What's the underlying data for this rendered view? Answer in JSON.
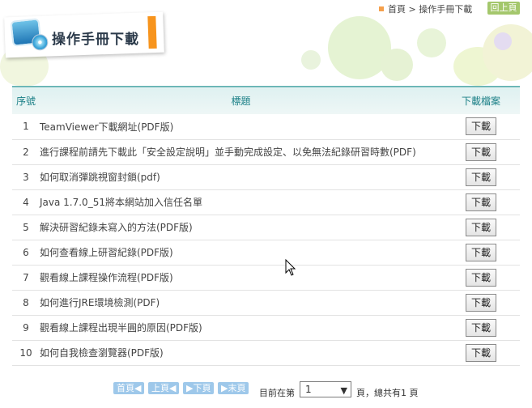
{
  "breadcrumb": {
    "home": "首頁",
    "separator": ">",
    "current": "操作手冊下載"
  },
  "back_button": "回上頁",
  "page_title": "操作手冊下載",
  "table": {
    "headers": {
      "no": "序號",
      "title": "標題",
      "download": "下載檔案"
    },
    "rows": [
      {
        "no": "1",
        "title": "TeamViewer下載網址(PDF版)",
        "download": "下載"
      },
      {
        "no": "2",
        "title": "進行課程前請先下載此「安全設定說明」並手動完成設定、以免無法紀錄研習時數(PDF)",
        "download": "下載"
      },
      {
        "no": "3",
        "title": "如何取消彈跳視窗封鎖(pdf)",
        "download": "下載"
      },
      {
        "no": "4",
        "title": "Java 1.7.0_51將本網站加入信任名單",
        "download": "下載"
      },
      {
        "no": "5",
        "title": "解決研習紀錄未寫入的方法(PDF版)",
        "download": "下載"
      },
      {
        "no": "6",
        "title": "如何查看線上研習紀錄(PDF版)",
        "download": "下載"
      },
      {
        "no": "7",
        "title": "觀看線上課程操作流程(PDF版)",
        "download": "下載"
      },
      {
        "no": "8",
        "title": "如何進行JRE環境檢測(PDF)",
        "download": "下載"
      },
      {
        "no": "9",
        "title": "觀看線上課程出現半圓的原因(PDF版)",
        "download": "下載"
      },
      {
        "no": "10",
        "title": "如何自我檢查瀏覽器(PDF版)",
        "download": "下載"
      }
    ]
  },
  "pager": {
    "first": "首頁◀",
    "prev": "上頁◀",
    "next": "▶下頁",
    "last": "▶末頁",
    "current_label": "目前在第",
    "current_page": "1",
    "total_label": "頁，總共有1 頁"
  },
  "colors": {
    "accent_orange": "#f7941d",
    "header_teal": "#1a7f86",
    "pager_blue": "#9ec8ea",
    "back_green": "#a4c76c"
  }
}
